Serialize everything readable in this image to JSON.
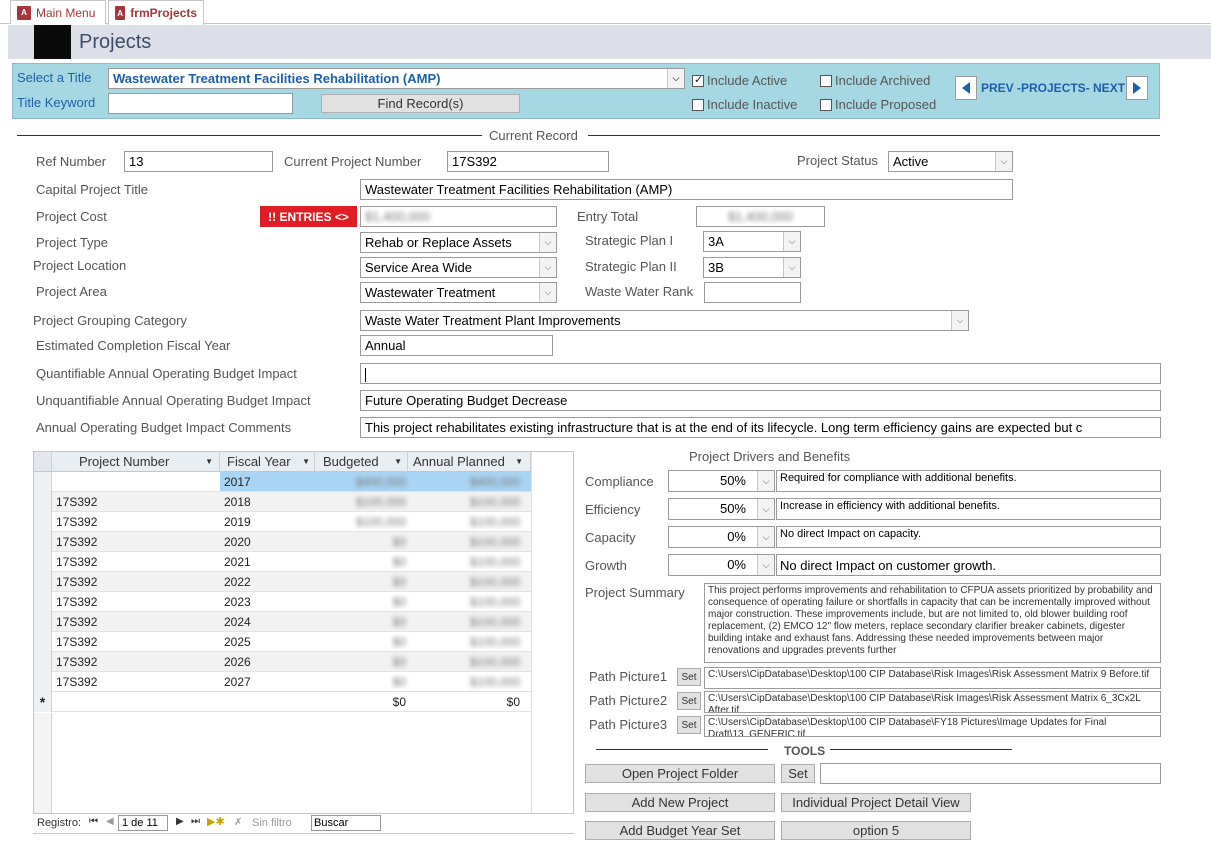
{
  "tabs": [
    {
      "label": "Main Menu",
      "icon": "access-form-icon"
    },
    {
      "label": "frmProjects",
      "icon": "access-form-icon"
    }
  ],
  "header": {
    "title": "Projects"
  },
  "selector": {
    "select_title_label": "Select a Title",
    "select_title_value": "Wastewater Treatment Facilities Rehabilitation (AMP)",
    "keyword_label": "Title Keyword",
    "keyword_value": "",
    "find_button": "Find Record(s)",
    "include_active": "Include Active",
    "include_inactive": "Include Inactive",
    "include_archived": "Include Archived",
    "include_proposed": "Include Proposed",
    "nav_label": "PREV -PROJECTS- NEXT"
  },
  "section": {
    "current_record": "Current Record",
    "drivers": "Project Drivers and Benefits",
    "tools": "TOOLS"
  },
  "record": {
    "ref_number_label": "Ref Number",
    "ref_number": "13",
    "current_project_number_label": "Current Project Number",
    "current_project_number": "17S392",
    "project_status_label": "Project Status",
    "project_status": "Active",
    "capital_title_label": "Capital Project Title",
    "capital_title": "Wastewater Treatment Facilities Rehabilitation (AMP)",
    "project_cost_label": "Project Cost",
    "entries_badge": "!! ENTRIES <>",
    "project_cost": "$1,400,000",
    "entry_total_label": "Entry Total",
    "entry_total": "$1,400,000",
    "project_type_label": "Project Type",
    "project_type": "Rehab or Replace Assets",
    "strategic1_label": "Strategic Plan I",
    "strategic1": "3A",
    "location_label": "Project Location",
    "location": "Service Area Wide",
    "strategic2_label": "Strategic Plan II",
    "strategic2": "3B",
    "area_label": "Project Area",
    "area": "Wastewater Treatment",
    "ww_rank_label": "Waste Water Rank",
    "ww_rank": "",
    "grouping_label": "Project Grouping Category",
    "grouping": "Waste Water Treatment Plant Improvements",
    "completion_label": "Estimated Completion Fiscal Year",
    "completion": "Annual",
    "quant_label": "Quantifiable Annual Operating Budget Impact",
    "quant": "",
    "unquant_label": "Unquantifiable Annual Operating Budget Impact",
    "unquant": "Future Operating Budget Decrease",
    "comments_label": "Annual Operating Budget Impact Comments",
    "comments": "This project rehabilitates existing infrastructure that is at the end of its lifecycle.  Long term efficiency gains are expected but c"
  },
  "grid": {
    "headers": [
      "Project Number",
      "Fiscal Year",
      "Budgeted",
      "Annual Planned"
    ],
    "rows": [
      {
        "pn": "",
        "fy": "2017",
        "b": "$400,000",
        "ap": "$400,000"
      },
      {
        "pn": "17S392",
        "fy": "2018",
        "b": "$100,000",
        "ap": "$100,000"
      },
      {
        "pn": "17S392",
        "fy": "2019",
        "b": "$100,000",
        "ap": "$100,000"
      },
      {
        "pn": "17S392",
        "fy": "2020",
        "b": "$0",
        "ap": "$100,000"
      },
      {
        "pn": "17S392",
        "fy": "2021",
        "b": "$0",
        "ap": "$100,000"
      },
      {
        "pn": "17S392",
        "fy": "2022",
        "b": "$0",
        "ap": "$100,000"
      },
      {
        "pn": "17S392",
        "fy": "2023",
        "b": "$0",
        "ap": "$100,000"
      },
      {
        "pn": "17S392",
        "fy": "2024",
        "b": "$0",
        "ap": "$100,000"
      },
      {
        "pn": "17S392",
        "fy": "2025",
        "b": "$0",
        "ap": "$100,000"
      },
      {
        "pn": "17S392",
        "fy": "2026",
        "b": "$0",
        "ap": "$100,000"
      },
      {
        "pn": "17S392",
        "fy": "2027",
        "b": "$0",
        "ap": "$100,000"
      }
    ],
    "new_row": {
      "marker": "*",
      "b": "$0",
      "ap": "$0"
    },
    "nav": {
      "label": "Registro:",
      "position": "1 de 11",
      "filter": "Sin filtro",
      "search": "Buscar"
    }
  },
  "drivers": [
    {
      "label": "Compliance",
      "pct": "50%",
      "text": "Required for compliance with additional benefits."
    },
    {
      "label": "Efficiency",
      "pct": "50%",
      "text": "Increase in efficiency with additional benefits."
    },
    {
      "label": "Capacity",
      "pct": "0%",
      "text": "No direct Impact on capacity."
    },
    {
      "label": "Growth",
      "pct": "0%",
      "text": "No direct Impact on customer growth."
    }
  ],
  "summary": {
    "label": "Project Summary",
    "text": "This project performs improvements and rehabilitation to CFPUA assets prioritized by probability and consequence of operating failure or shortfalls in capacity that can be incrementally improved without major construction. These improvements include, but are not limited to, old blower building roof replacement, (2) EMCO 12\" flow meters, replace secondary clarifier breaker cabinets, digester building intake and exhaust fans. Addressing these needed improvements between major renovations and upgrades prevents further"
  },
  "pictures": [
    {
      "label": "Path Picture1",
      "set": "Set",
      "path": "C:\\Users\\CipDatabase\\Desktop\\100 CIP Database\\Risk Images\\Risk Assessment Matrix 9 Before.tif"
    },
    {
      "label": "Path Picture2",
      "set": "Set",
      "path": "C:\\Users\\CipDatabase\\Desktop\\100 CIP Database\\Risk Images\\Risk Assessment Matrix 6_3Cx2L After.tif"
    },
    {
      "label": "Path Picture3",
      "set": "Set",
      "path": "C:\\Users\\CipDatabase\\Desktop\\100 CIP Database\\FY18 Pictures\\Image Updates for Final Draft\\13_GENERIC.tif"
    }
  ],
  "tools": {
    "open_folder": "Open Project Folder",
    "set": "Set",
    "folder_path": "",
    "add_new": "Add New Project",
    "detail_view": "Individual Project Detail View",
    "add_budget": "Add Budget Year Set",
    "option5": "option 5"
  },
  "colors": {
    "panel": "#a6d8e4",
    "accent_blue": "#1f5fa8",
    "badge_red": "#e01c24",
    "selected_row": "#a9d4f3"
  }
}
